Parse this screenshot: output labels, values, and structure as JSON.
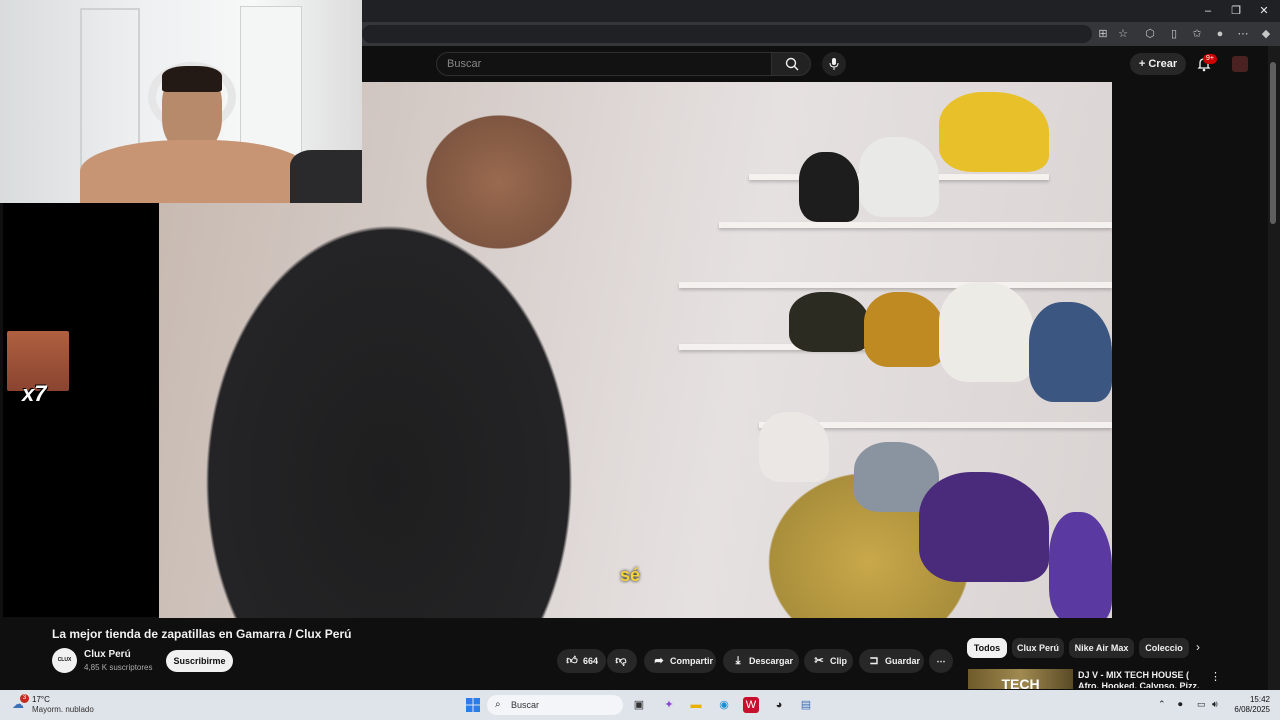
{
  "browser": {
    "window_controls": {
      "minimize": "–",
      "maximize": "❐",
      "close": "✕"
    }
  },
  "youtube_header": {
    "search_placeholder": "Buscar",
    "create_label": "Crear",
    "notification_count": "9+"
  },
  "video": {
    "caption": "sé",
    "emote_count": "x7"
  },
  "details": {
    "title": "La mejor tienda de zapatillas en Gamarra / Clux Perú",
    "channel_avatar_text": "CLUX",
    "channel_name": "Clux Perú",
    "subscribers": "4,85 K suscriptores",
    "subscribe_label": "Suscribirme",
    "like_count": "664",
    "share_label": "Compartir",
    "download_label": "Descargar",
    "clip_label": "Clip",
    "save_label": "Guardar"
  },
  "chips": [
    "Todos",
    "Clux Perú",
    "Nike Air Max",
    "Coleccio"
  ],
  "recommendation": {
    "thumb_text": "TECH",
    "title": "DJ V - MIX TECH HOUSE ( Afro, Hooked, Calypso, Pizz, Bololo"
  },
  "taskbar": {
    "weather_temp": "17°C",
    "weather_desc": "Mayorm. nublado",
    "weather_badge": "3",
    "search_label": "Buscar",
    "time": "15:42",
    "date": "6/08/2025"
  },
  "colors": {
    "page_bg": "#0f0f0f",
    "subscribe_bg": "#f1f1f1",
    "notification_badge": "#cc0000",
    "caption_color": "#f3d33c",
    "taskbar_bg": "#dfe3ea"
  }
}
